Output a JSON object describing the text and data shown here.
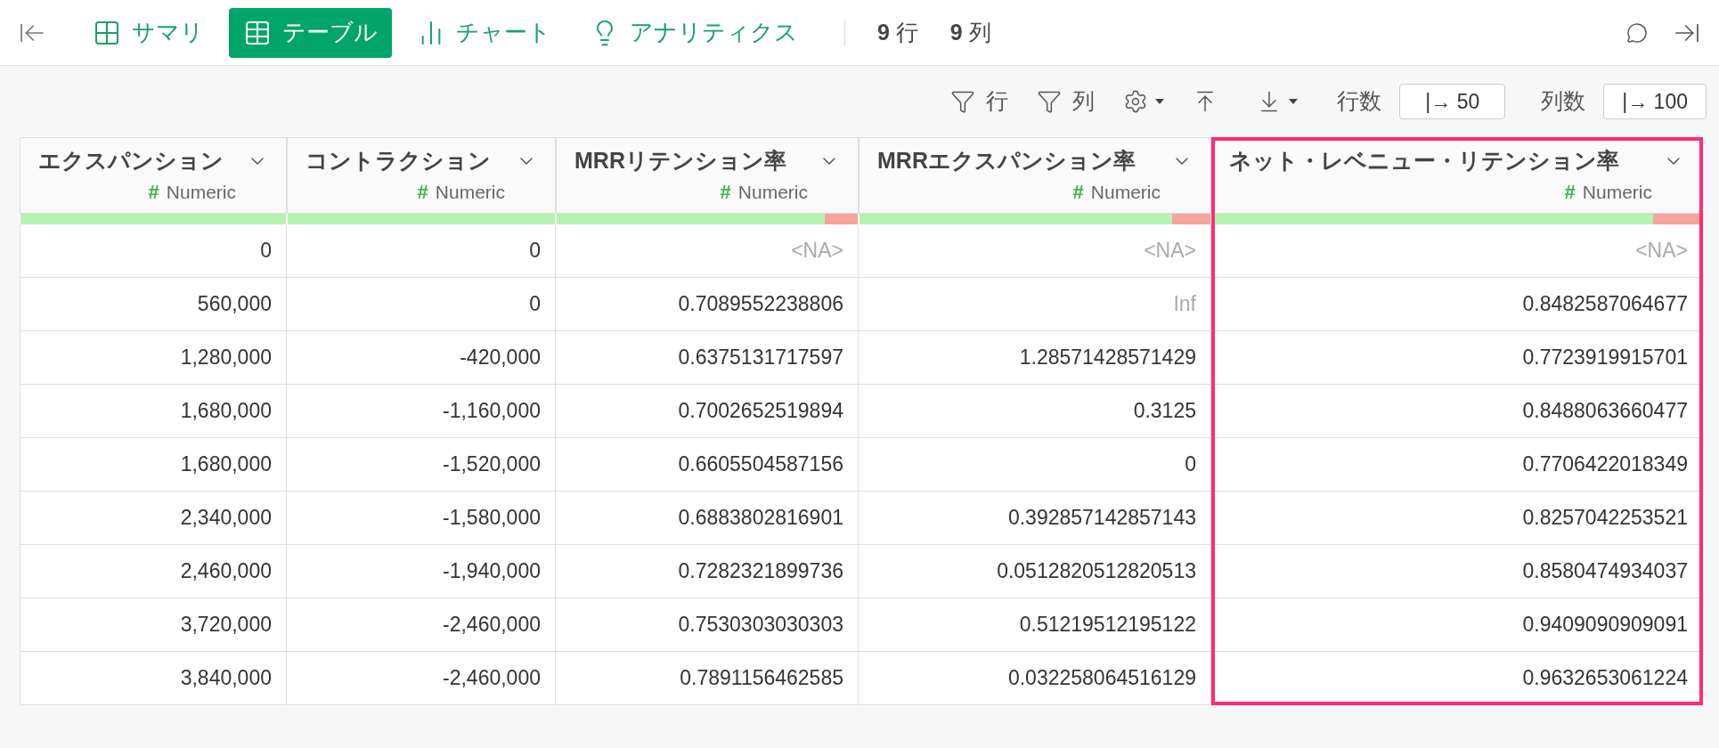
{
  "nav": {
    "tabs": [
      {
        "label": "サマリ",
        "selected": false
      },
      {
        "label": "テーブル",
        "selected": true
      },
      {
        "label": "チャート",
        "selected": false
      },
      {
        "label": "アナリティクス",
        "selected": false
      }
    ],
    "stats": [
      {
        "count": "9",
        "unit": "行"
      },
      {
        "count": "9",
        "unit": "列"
      }
    ]
  },
  "toolbar": {
    "row_filter": "行",
    "column_filter": "列",
    "row_count_label": "行数",
    "row_count": "|→ 50",
    "column_count_label": "列数",
    "column_count": "|→ 100"
  },
  "columns": [
    {
      "name": "エクスパンション",
      "type_symbol": "#",
      "type": "Numeric",
      "level": 1,
      "selected": false,
      "cells": [
        {
          "text": "0",
          "missing": false
        },
        {
          "text": "560,000",
          "missing": false
        },
        {
          "text": "1,280,000",
          "missing": false
        },
        {
          "text": "1,680,000",
          "missing": false
        },
        {
          "text": "1,680,000",
          "missing": false
        },
        {
          "text": "2,340,000",
          "missing": false
        },
        {
          "text": "2,460,000",
          "missing": false
        },
        {
          "text": "3,720,000",
          "missing": false
        },
        {
          "text": "3,840,000",
          "missing": false
        }
      ]
    },
    {
      "name": "コントラクション",
      "type_symbol": "#",
      "type": "Numeric",
      "level": 1,
      "selected": false,
      "cells": [
        {
          "text": "0",
          "missing": false
        },
        {
          "text": "0",
          "missing": false
        },
        {
          "text": "-420,000",
          "missing": false
        },
        {
          "text": "-1,160,000",
          "missing": false
        },
        {
          "text": "-1,520,000",
          "missing": false
        },
        {
          "text": "-1,580,000",
          "missing": false
        },
        {
          "text": "-1,940,000",
          "missing": false
        },
        {
          "text": "-2,460,000",
          "missing": false
        },
        {
          "text": "-2,460,000",
          "missing": false
        }
      ]
    },
    {
      "name": "MRRリテンション率",
      "type_symbol": "#",
      "type": "Numeric",
      "level": 0.89,
      "selected": false,
      "cells": [
        {
          "text": "<NA>",
          "missing": true
        },
        {
          "text": "0.7089552238806",
          "missing": false
        },
        {
          "text": "0.6375131717597",
          "missing": false
        },
        {
          "text": "0.7002652519894",
          "missing": false
        },
        {
          "text": "0.6605504587156",
          "missing": false
        },
        {
          "text": "0.6883802816901",
          "missing": false
        },
        {
          "text": "0.7282321899736",
          "missing": false
        },
        {
          "text": "0.7530303030303",
          "missing": false
        },
        {
          "text": "0.7891156462585",
          "missing": false
        }
      ]
    },
    {
      "name": "MRRエクスパンション率",
      "type_symbol": "#",
      "type": "Numeric",
      "level": 0.89,
      "selected": false,
      "cells": [
        {
          "text": "<NA>",
          "missing": true
        },
        {
          "text": "Inf",
          "missing": true
        },
        {
          "text": "1.28571428571429",
          "missing": false
        },
        {
          "text": "0.3125",
          "missing": false
        },
        {
          "text": "0",
          "missing": false
        },
        {
          "text": "0.392857142857143",
          "missing": false
        },
        {
          "text": "0.0512820512820513",
          "missing": false
        },
        {
          "text": "0.51219512195122",
          "missing": false
        },
        {
          "text": "0.032258064516129",
          "missing": false
        }
      ]
    },
    {
      "name": "ネット・レベニュー・リテンション率",
      "type_symbol": "#",
      "type": "Numeric",
      "level": 0.9,
      "selected": true,
      "cells": [
        {
          "text": "<NA>",
          "missing": true
        },
        {
          "text": "0.8482587064677",
          "missing": false
        },
        {
          "text": "0.7723919915701",
          "missing": false
        },
        {
          "text": "0.8488063660477",
          "missing": false
        },
        {
          "text": "0.7706422018349",
          "missing": false
        },
        {
          "text": "0.8257042253521",
          "missing": false
        },
        {
          "text": "0.8580474934037",
          "missing": false
        },
        {
          "text": "0.9409090909091",
          "missing": false
        },
        {
          "text": "0.9632653061224",
          "missing": false
        }
      ]
    }
  ]
}
